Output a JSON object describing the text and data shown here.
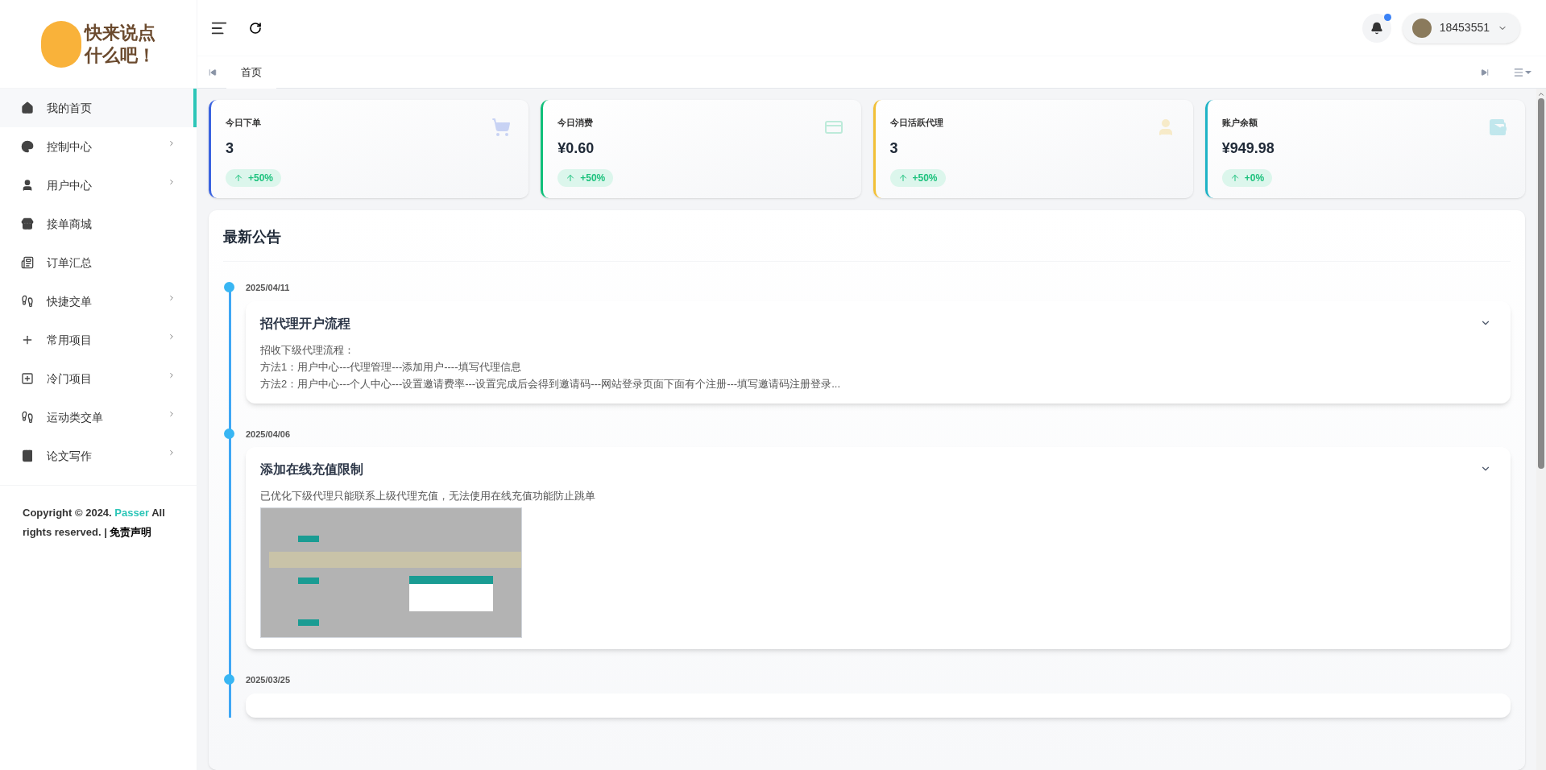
{
  "logo": {
    "text_line_1": "快来说点",
    "text_line_2": "什么吧！"
  },
  "sidebar": {
    "items": [
      {
        "label": "我的首页",
        "selected": true,
        "expandable": false
      },
      {
        "label": "控制中心",
        "selected": false,
        "expandable": true
      },
      {
        "label": "用户中心",
        "selected": false,
        "expandable": true
      },
      {
        "label": "接单商城",
        "selected": false,
        "expandable": false
      },
      {
        "label": "订单汇总",
        "selected": false,
        "expandable": false
      },
      {
        "label": "快捷交单",
        "selected": false,
        "expandable": true
      },
      {
        "label": "常用项目",
        "selected": false,
        "expandable": true
      },
      {
        "label": "冷门项目",
        "selected": false,
        "expandable": true
      },
      {
        "label": "运动类交单",
        "selected": false,
        "expandable": true
      },
      {
        "label": "论文写作",
        "selected": false,
        "expandable": true
      }
    ],
    "footer": {
      "text": "Copyright © 2024.",
      "link": "Passer",
      "text_2": "All rights reserved. |",
      "disclaimer": "免责声明"
    }
  },
  "header": {
    "notifications": {
      "unread": true
    },
    "user": {
      "name": "18453551"
    }
  },
  "tabs": [
    {
      "label": "首页",
      "selected": true
    }
  ],
  "stats": [
    {
      "label": "今日下单",
      "value": "3",
      "change": "+50%",
      "color": "#3b63e0"
    },
    {
      "label": "今日消费",
      "value": "¥0.60",
      "change": "+50%",
      "color": "#10c07a"
    },
    {
      "label": "今日活跃代理",
      "value": "3",
      "change": "+50%",
      "color": "#f2c037"
    },
    {
      "label": "账户余额",
      "value": "¥949.98",
      "change": "+0%",
      "color": "#1eb3c6"
    }
  ],
  "announcements": {
    "title": "最新公告",
    "items": [
      {
        "date": "2025/04/11",
        "title": "招代理开户流程",
        "lines": [
          "招收下级代理流程：",
          "方法1：用户中心---代理管理---添加用户----填写代理信息",
          "方法2：用户中心---个人中心---设置邀请费率---设置完成后会得到邀请码---网站登录页面下面有个注册---填写邀请码注册登录..."
        ],
        "screenshot": false
      },
      {
        "date": "2025/04/06",
        "title": "添加在线充值限制",
        "lines": [
          "已优化下级代理只能联系上级代理充值，无法使用在线充值功能防止跳单"
        ],
        "screenshot": true
      },
      {
        "date": "2025/03/25",
        "screenshot": false
      }
    ]
  }
}
